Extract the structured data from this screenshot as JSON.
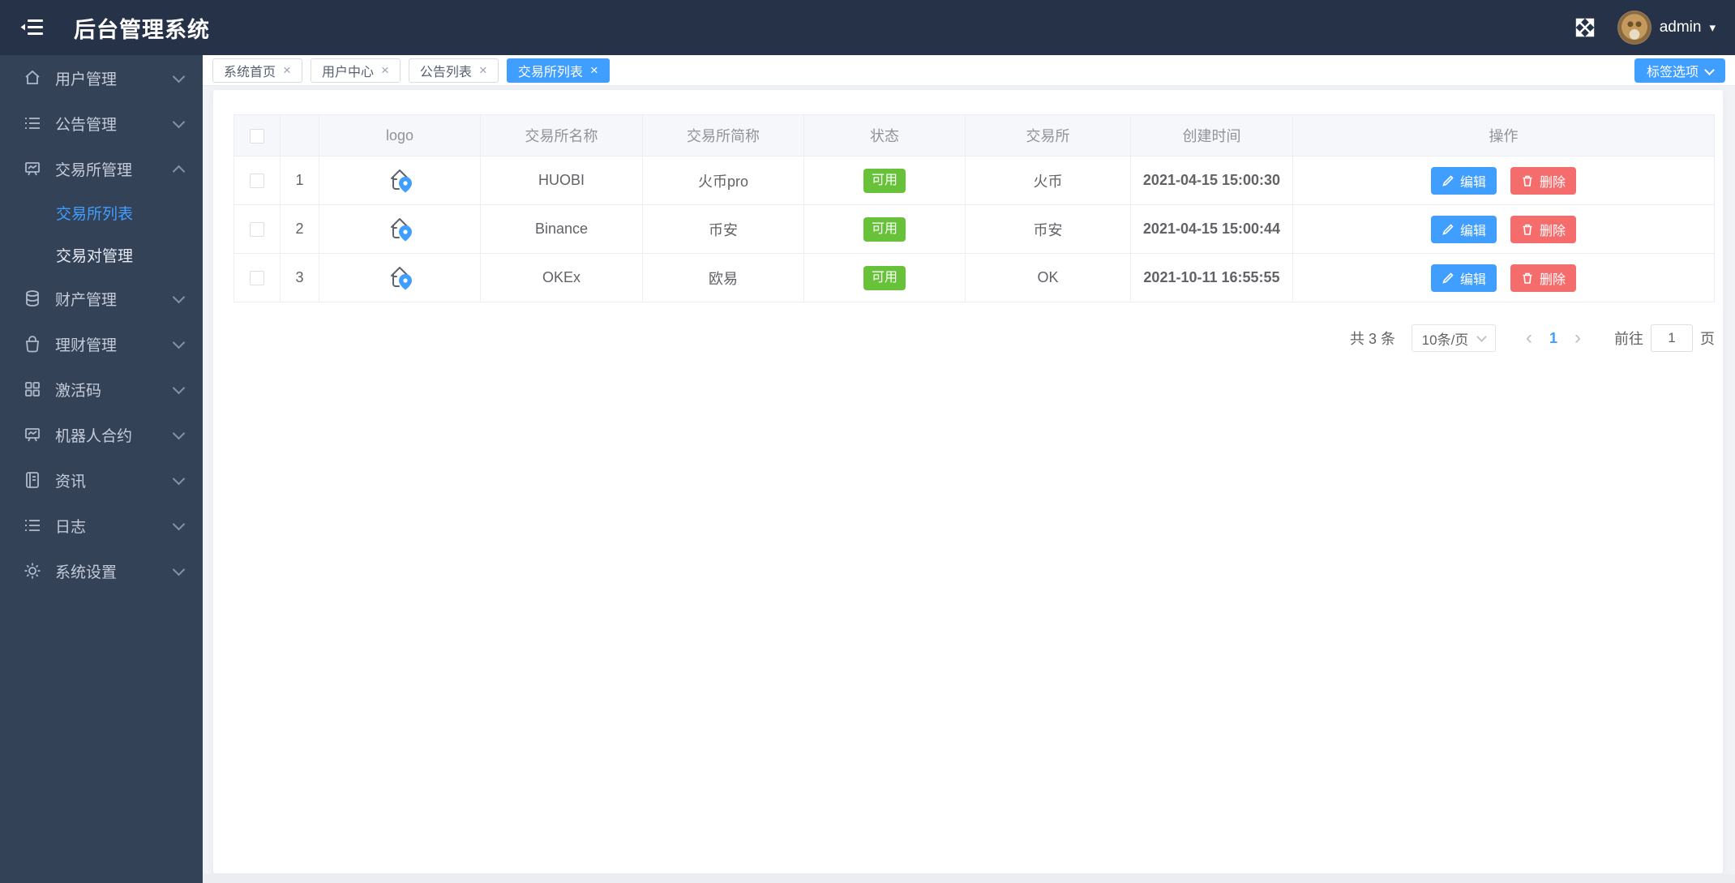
{
  "header": {
    "title": "后台管理系统",
    "username": "admin"
  },
  "icons": {
    "close": "×",
    "caret_down": "▾",
    "prev": "‹",
    "next": "›"
  },
  "sidebar": {
    "items": [
      {
        "label": "用户管理",
        "icon": "home-icon"
      },
      {
        "label": "公告管理",
        "icon": "list-icon"
      },
      {
        "label": "交易所管理",
        "icon": "board-icon",
        "expanded": true,
        "children": [
          {
            "label": "交易所列表",
            "active": true
          },
          {
            "label": "交易对管理",
            "active": false
          }
        ]
      },
      {
        "label": "财产管理",
        "icon": "coins-icon"
      },
      {
        "label": "理财管理",
        "icon": "bag-icon"
      },
      {
        "label": "激活码",
        "icon": "grid-icon"
      },
      {
        "label": "机器人合约",
        "icon": "board-icon"
      },
      {
        "label": "资讯",
        "icon": "news-icon"
      },
      {
        "label": "日志",
        "icon": "list-icon"
      },
      {
        "label": "系统设置",
        "icon": "gear-icon"
      }
    ]
  },
  "tabs": [
    {
      "label": "系统首页",
      "active": false
    },
    {
      "label": "用户中心",
      "active": false
    },
    {
      "label": "公告列表",
      "active": false
    },
    {
      "label": "交易所列表",
      "active": true
    }
  ],
  "tags_button_label": "标签选项",
  "table": {
    "columns": [
      "logo",
      "交易所名称",
      "交易所简称",
      "状态",
      "交易所",
      "创建时间",
      "操作"
    ],
    "rows": [
      {
        "index": "1",
        "name": "HUOBI",
        "short_name": "火币pro",
        "status": "可用",
        "exchange": "火币",
        "created": "2021-04-15 15:00:30"
      },
      {
        "index": "2",
        "name": "Binance",
        "short_name": "币安",
        "status": "可用",
        "exchange": "币安",
        "created": "2021-04-15 15:00:44"
      },
      {
        "index": "3",
        "name": "OKEx",
        "short_name": "欧易",
        "status": "可用",
        "exchange": "OK",
        "created": "2021-10-11 16:55:55"
      }
    ]
  },
  "actions": {
    "edit": "编辑",
    "delete": "删除"
  },
  "pagination": {
    "total": "共 3 条",
    "page_size": "10条/页",
    "current_page": "1",
    "goto_label": "前往",
    "goto_value": "1",
    "unit": "页"
  },
  "colors": {
    "primary": "#409eff",
    "success": "#67c23a",
    "danger": "#f56c6c",
    "header_bg": "#263247",
    "sidebar_bg": "#344258"
  }
}
